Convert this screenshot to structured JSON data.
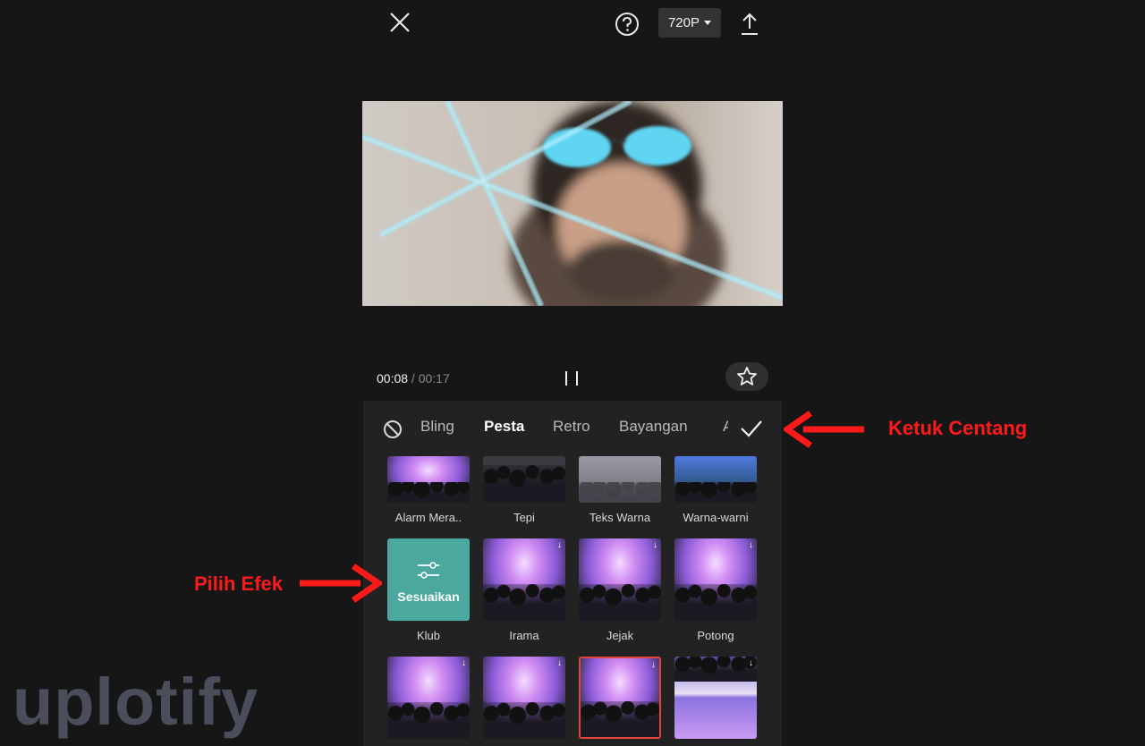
{
  "topbar": {
    "resolution_label": "720P"
  },
  "playback": {
    "current_time": "00:08",
    "separator": " / ",
    "total_time": "00:17"
  },
  "effects_panel": {
    "tabs": [
      "Bling",
      "Pesta",
      "Retro",
      "Bayangan",
      "A"
    ],
    "active_tab": "Pesta",
    "row1": [
      "Alarm Mera..",
      "Tepi",
      "Teks Warna",
      "Warna-warni"
    ],
    "row2": [
      "Klub",
      "Irama",
      "Jejak",
      "Potong"
    ],
    "adjust_label": "Sesuaikan"
  },
  "annotations": {
    "confirm_hint": "Ketuk Centang",
    "select_hint": "Pilih Efek"
  },
  "watermark": "uplotify",
  "colors": {
    "annotation": "#ff1a1a",
    "adjust_tile": "#4aa89e",
    "selected_border": "#e0443a"
  }
}
